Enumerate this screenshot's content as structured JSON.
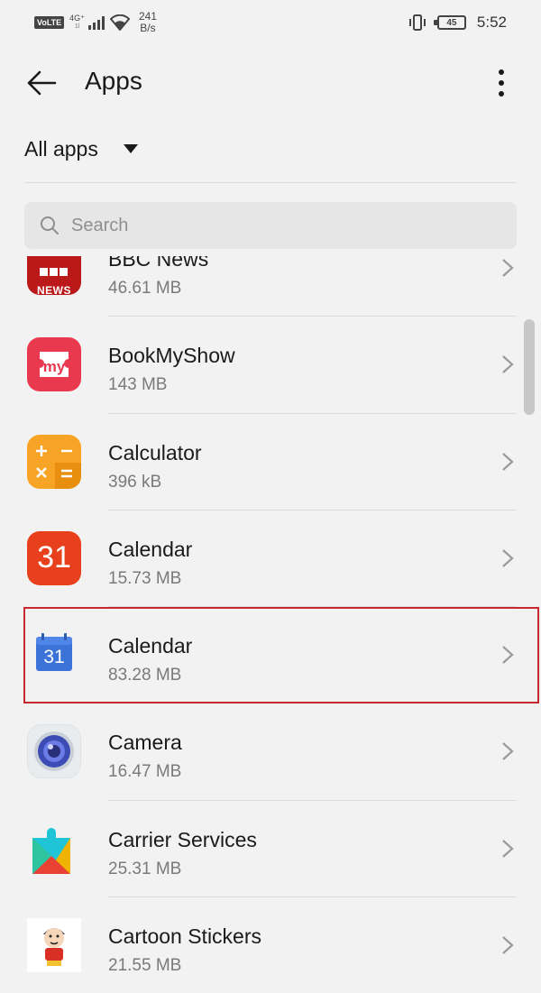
{
  "status_bar": {
    "volte": "VoLTE",
    "network": "4G⁺",
    "network_sub": "1l",
    "speed_value": "241",
    "speed_unit": "B/s",
    "battery": "45",
    "time": "5:52"
  },
  "app_bar": {
    "back_icon": "arrow-back-icon",
    "title": "Apps",
    "more_icon": "more-vert-icon"
  },
  "filter": {
    "label": "All apps"
  },
  "search": {
    "placeholder": "Search"
  },
  "apps": [
    {
      "name": "BBC News",
      "size": "46.61 MB",
      "icon": "bbc-news-icon",
      "icon_text": "NEWS"
    },
    {
      "name": "BookMyShow",
      "size": "143 MB",
      "icon": "bookmyshow-icon"
    },
    {
      "name": "Calculator",
      "size": "396 kB",
      "icon": "calculator-icon"
    },
    {
      "name": "Calendar",
      "size": "15.73 MB",
      "icon": "calendar-icon",
      "icon_text": "31"
    },
    {
      "name": "Calendar",
      "size": "83.28 MB",
      "icon": "google-calendar-icon",
      "icon_text": "31"
    },
    {
      "name": "Camera",
      "size": "16.47 MB",
      "icon": "camera-icon"
    },
    {
      "name": "Carrier Services",
      "size": "25.31 MB",
      "icon": "carrier-services-icon"
    },
    {
      "name": "Cartoon Stickers",
      "size": "21.55 MB",
      "icon": "cartoon-stickers-icon"
    }
  ],
  "highlighted_index": 4,
  "colors": {
    "background": "#f2f2f2",
    "highlight_border": "#c8282e",
    "secondary_text": "#7a7a7a"
  }
}
